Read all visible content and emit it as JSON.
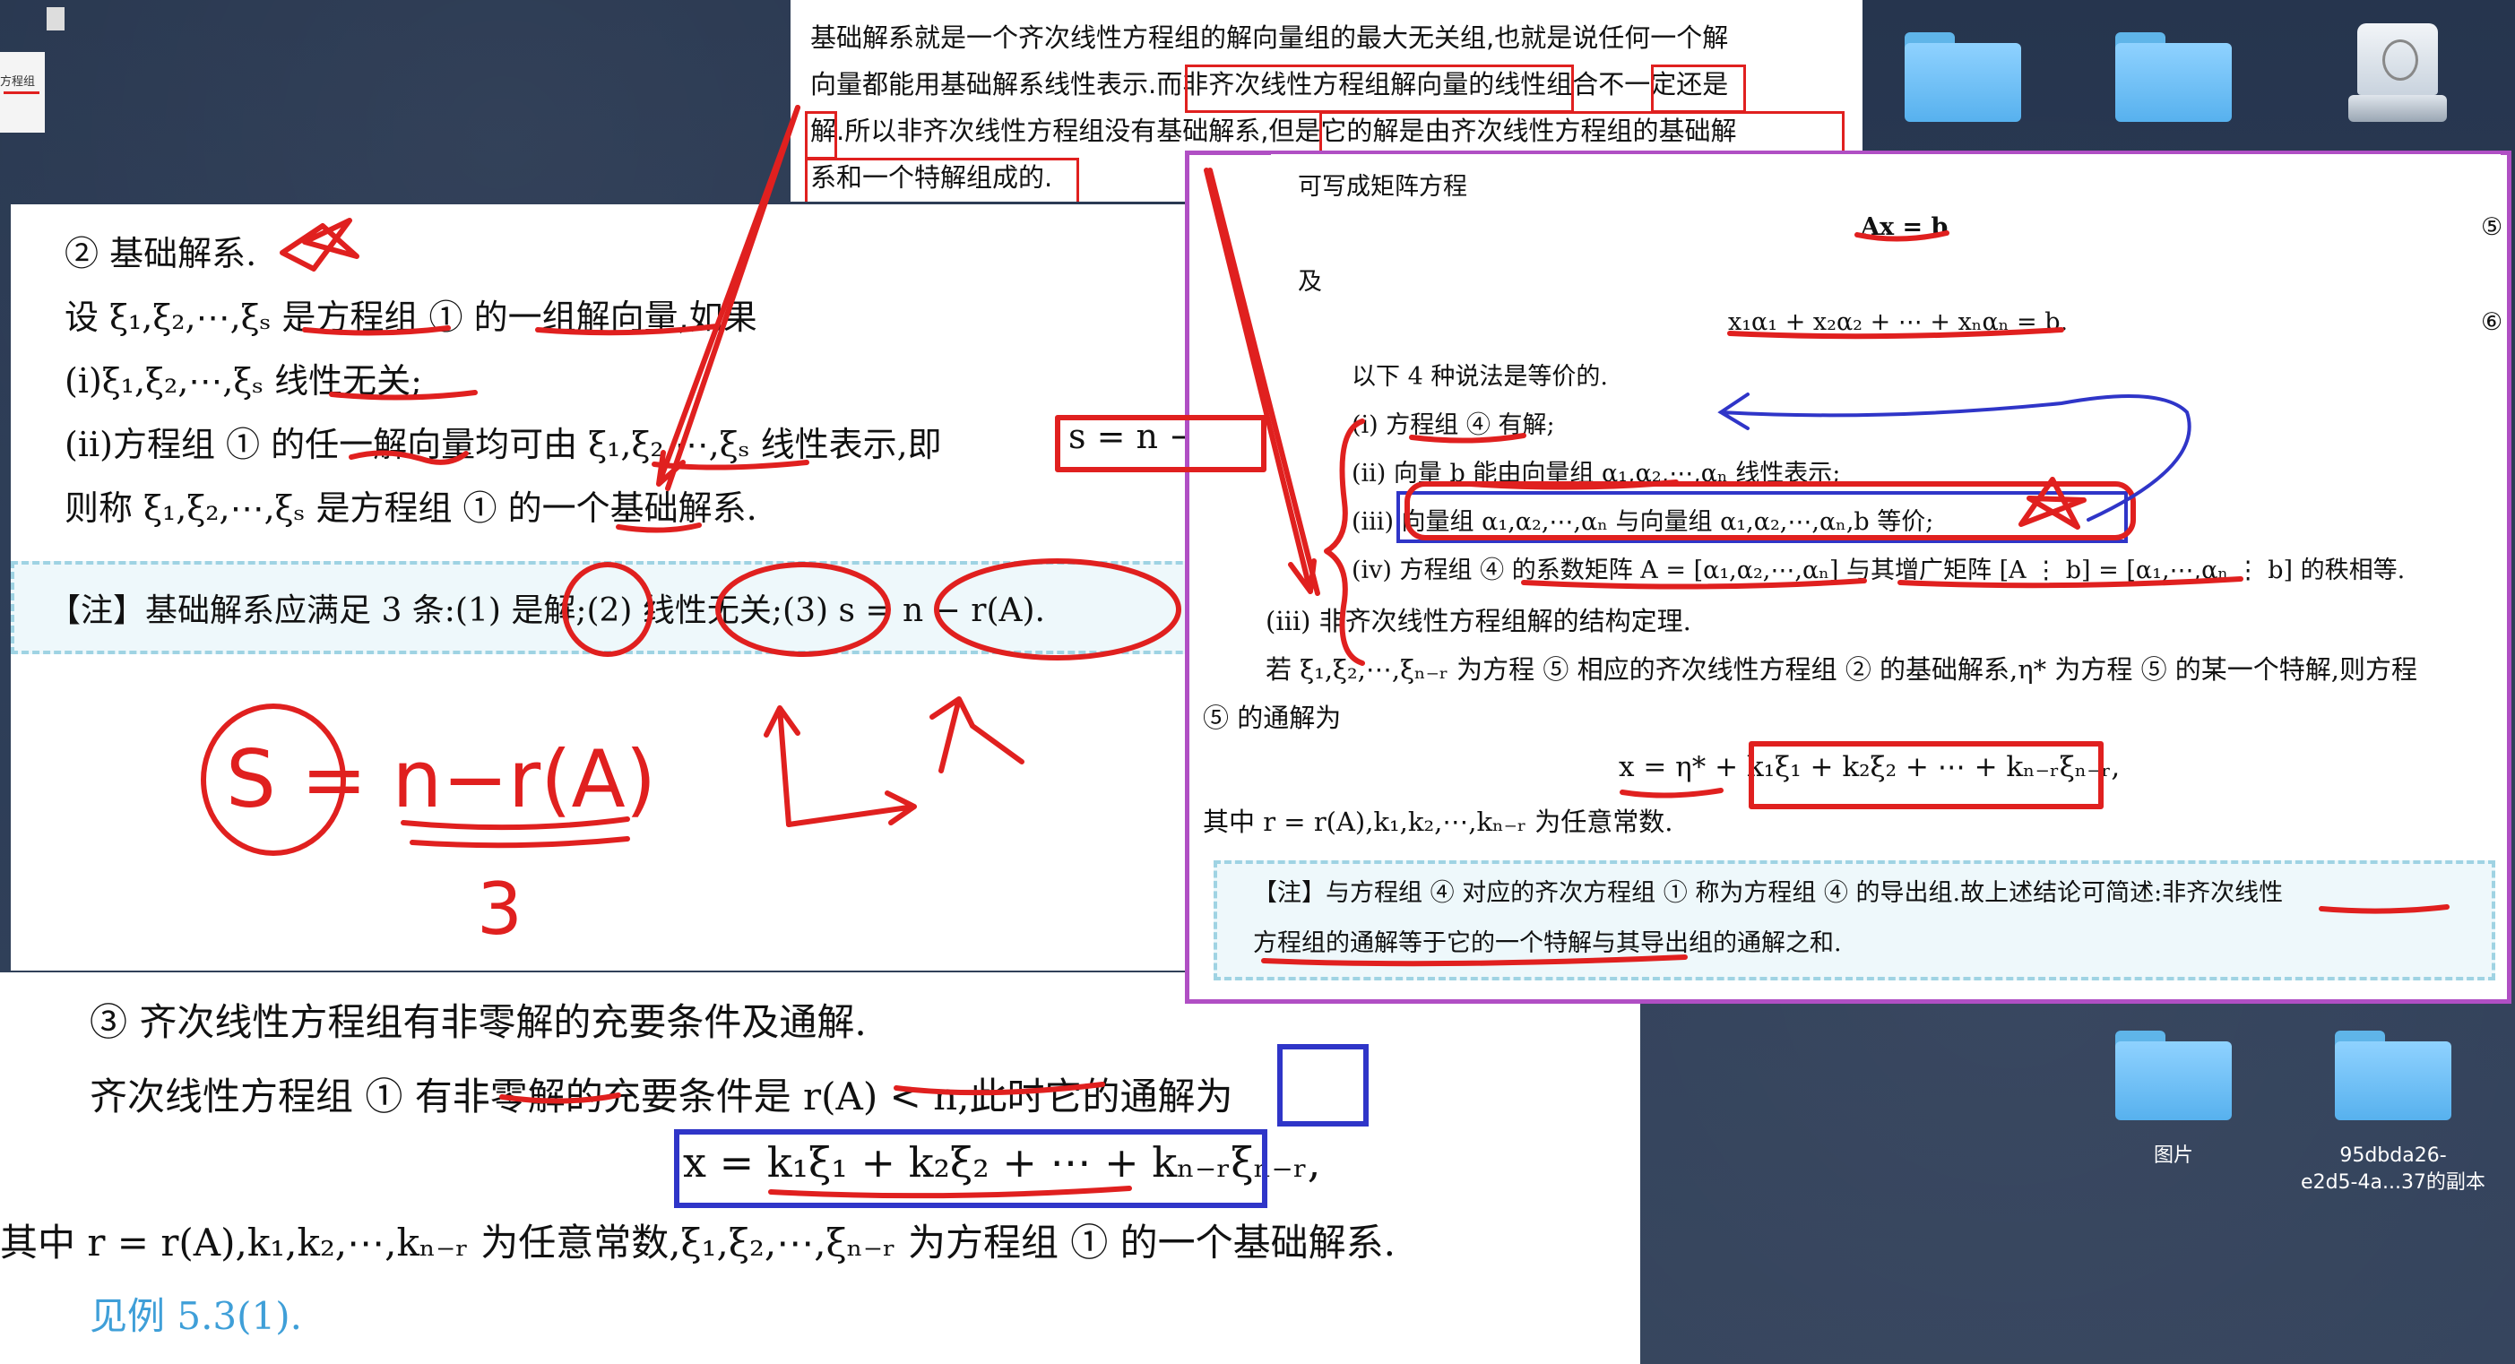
{
  "desktop": {
    "folders": [
      {
        "name": ""
      },
      {
        "name": ""
      },
      {
        "name": "图片"
      },
      {
        "name": "95dbda26-\ne2d5-4a...37的副本"
      }
    ],
    "thumb_label": "方程组"
  },
  "top_note": {
    "line1": "基础解系就是一个齐次线性方程组的解向量组的最大无关组,也就是说任何一个解",
    "line2": "向量都能用基础解系线性表示.而非齐次线性方程组解向量的线性组合不一定还是",
    "line3": "解.所以非齐次线性方程组没有基础解系,但是它的解是由齐次线性方程组的基础解",
    "line4": "系和一个特解组成的."
  },
  "left_panel": {
    "heading": "② 基础解系.",
    "l1": "设 ξ₁,ξ₂,⋯,ξₛ 是方程组 ① 的一组解向量,如果",
    "l2": "(ⅰ)ξ₁,ξ₂,⋯,ξₛ 线性无关;",
    "l3": "(ⅱ)方程组 ① 的任一解向量均可由 ξ₁,ξ₂,⋯,ξₛ 线性表示,即",
    "l3b": "s = n − r(A)",
    "l4": "则称 ξ₁,ξ₂,⋯,ξₛ 是方程组 ① 的一个基础解系.",
    "note": "【注】基础解系应满足 3 条:(1) 是解;(2) 线性无关;(3) s = n − r(A).",
    "hand1": "S = n−r(A)",
    "hand2": "3"
  },
  "bottom_panel": {
    "heading": "③ 齐次线性方程组有非零解的充要条件及通解.",
    "l1": "齐次线性方程组 ① 有非零解的充要条件是 r(A) < n,此时它的通解为",
    "formula": "x = k₁ξ₁ + k₂ξ₂ + ⋯ + kₙ₋ᵣξₙ₋ᵣ,",
    "l2": "其中 r = r(A),k₁,k₂,⋯,kₙ₋ᵣ 为任意常数,ξ₁,ξ₂,⋯,ξₙ₋ᵣ 为方程组 ① 的一个基础解系.",
    "link": "见例 5.3(1)."
  },
  "right_top": {
    "l0": "可写成矩阵方程",
    "eq1": "Ax = b",
    "l1": "及",
    "eq2": "x₁α₁ + x₂α₂ + ⋯ + xₙαₙ = b.",
    "l2": "以下 4 种说法是等价的.",
    "i": "(ⅰ) 方程组 ④ 有解;",
    "ii": "(ⅱ) 向量 b 能由向量组 α₁,α₂,⋯,αₙ 线性表示;",
    "iii": "(ⅲ) 向量组 α₁,α₂,⋯,αₙ 与向量组 α₁,α₂,⋯,αₙ,b 等价;",
    "iv": "(ⅳ) 方程组 ④ 的系数矩阵 A = [α₁,α₂,⋯,αₙ] 与其增广矩阵 [A ⋮ b] = [α₁,⋯,αₙ ⋮ b] 的秩相等.",
    "n5": "⑤",
    "n6": "⑥"
  },
  "right_bottom": {
    "heading": "(ⅲ) 非齐次线性方程组解的结构定理.",
    "l1": "若 ξ₁,ξ₂,⋯,ξₙ₋ᵣ 为方程 ⑤ 相应的齐次线性方程组 ② 的基础解系,η* 为方程 ⑤ 的某一个特解,则方程",
    "l2": "⑤ 的通解为",
    "formula": "x = η* + k₁ξ₁ + k₂ξ₂ + ⋯ + kₙ₋ᵣξₙ₋ᵣ,",
    "l3": "其中 r = r(A),k₁,k₂,⋯,kₙ₋ᵣ 为任意常数.",
    "note1": "【注】与方程组 ④ 对应的齐次方程组 ① 称为方程组 ④ 的导出组.故上述结论可简述:非齐次线性",
    "note2": "方程组的通解等于它的一个特解与其导出组的通解之和."
  },
  "colors": {
    "ink": "#e0201f",
    "blue_ink": "#2f35c8",
    "purple_frame": "#b04fc4",
    "link": "#3f9fd8"
  }
}
